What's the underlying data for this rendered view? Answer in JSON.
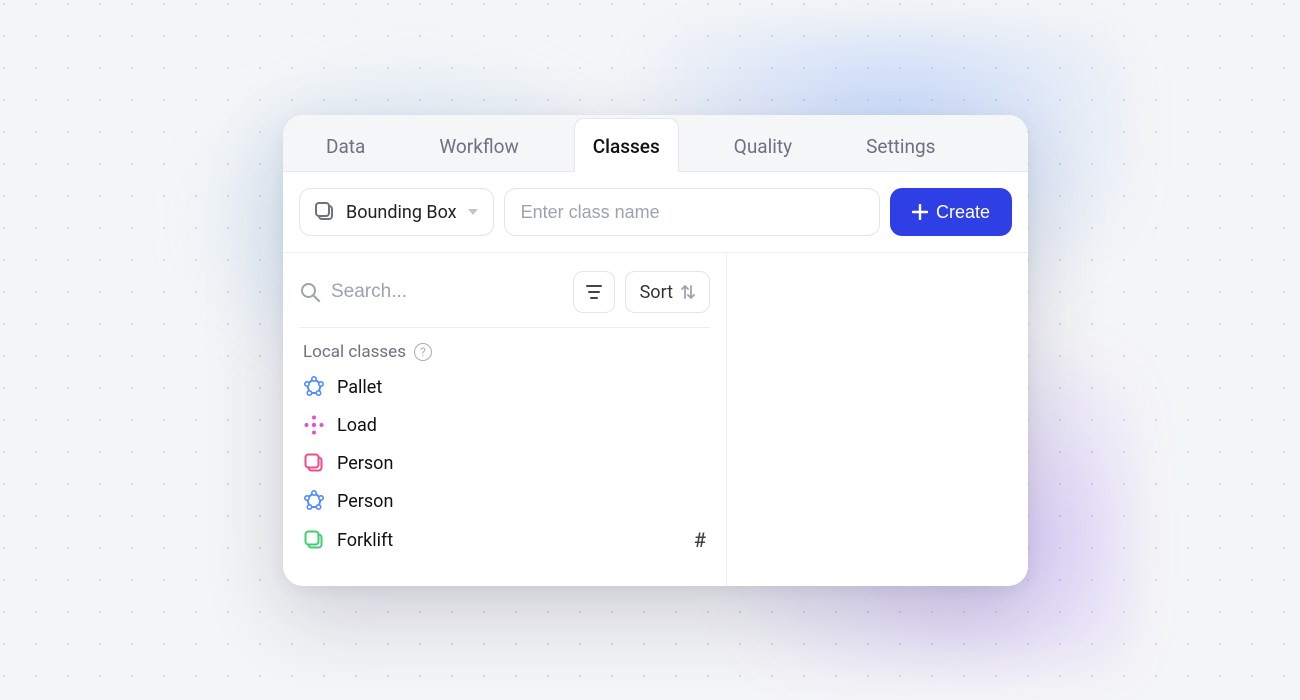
{
  "tabs": [
    {
      "label": "Data",
      "active": false
    },
    {
      "label": "Workflow",
      "active": false
    },
    {
      "label": "Classes",
      "active": true
    },
    {
      "label": "Quality",
      "active": false
    },
    {
      "label": "Settings",
      "active": false
    }
  ],
  "toolbar": {
    "type_selector": {
      "label": "Bounding Box",
      "icon": "bbox-icon"
    },
    "classname_placeholder": "Enter class name",
    "create_label": "Create"
  },
  "search": {
    "placeholder": "Search...",
    "sort_label": "Sort"
  },
  "sections": {
    "local_classes_label": "Local classes"
  },
  "classes": [
    {
      "name": "Pallet",
      "icon": "polygon-icon",
      "color": "#4f8cff",
      "has_id": false
    },
    {
      "name": "Load",
      "icon": "keypoint-icon",
      "color": "#e255c7",
      "has_id": false
    },
    {
      "name": "Person",
      "icon": "bbox-icon",
      "color": "#ec4b8f",
      "has_id": false
    },
    {
      "name": "Person",
      "icon": "polygon-icon",
      "color": "#4f8cff",
      "has_id": false
    },
    {
      "name": "Forklift",
      "icon": "bbox-icon",
      "color": "#3fcf72",
      "has_id": true
    }
  ]
}
